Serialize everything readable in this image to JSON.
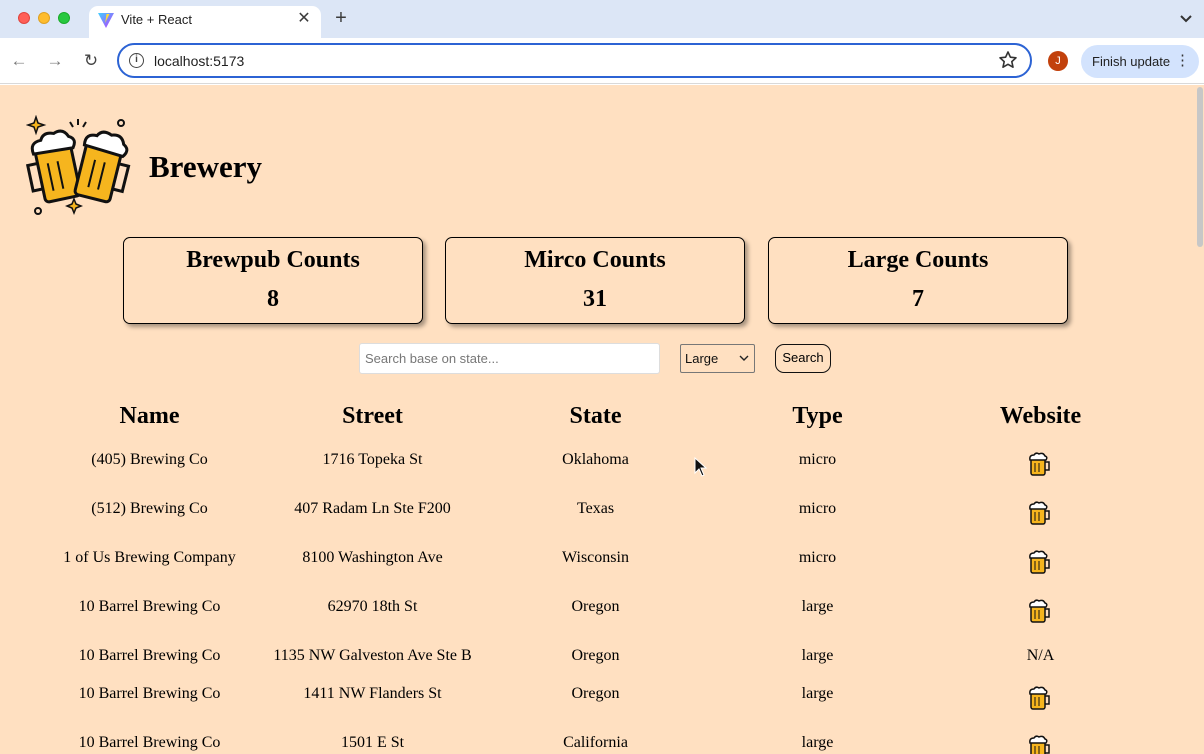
{
  "browser": {
    "tab_title": "Vite + React",
    "url": "localhost:5173",
    "profile_initial": "J",
    "finish_update_label": "Finish update"
  },
  "app": {
    "brand": "Brewery"
  },
  "stats": [
    {
      "label": "Brewpub Counts",
      "value": "8"
    },
    {
      "label": "Mirco Counts",
      "value": "31"
    },
    {
      "label": "Large Counts",
      "value": "7"
    }
  ],
  "search": {
    "placeholder": "Search base on state...",
    "value": "",
    "type_selected": "Large",
    "button_label": "Search"
  },
  "table": {
    "headers": [
      "Name",
      "Street",
      "State",
      "Type",
      "Website"
    ],
    "rows": [
      {
        "name": "(405) Brewing Co",
        "street": "1716 Topeka St",
        "state": "Oklahoma",
        "type": "micro",
        "website": "beer-mug-icon"
      },
      {
        "name": "(512) Brewing Co",
        "street": "407 Radam Ln Ste F200",
        "state": "Texas",
        "type": "micro",
        "website": "beer-mug-icon"
      },
      {
        "name": "1 of Us Brewing Company",
        "street": "8100 Washington Ave",
        "state": "Wisconsin",
        "type": "micro",
        "website": "beer-mug-icon"
      },
      {
        "name": "10 Barrel Brewing Co",
        "street": "62970 18th St",
        "state": "Oregon",
        "type": "large",
        "website": "beer-mug-icon"
      },
      {
        "name": "10 Barrel Brewing Co",
        "street": "1135 NW Galveston Ave Ste B",
        "state": "Oregon",
        "type": "large",
        "website": "N/A"
      },
      {
        "name": "10 Barrel Brewing Co",
        "street": "1411 NW Flanders St",
        "state": "Oregon",
        "type": "large",
        "website": "beer-mug-icon"
      },
      {
        "name": "10 Barrel Brewing Co",
        "street": "1501 E St",
        "state": "California",
        "type": "large",
        "website": "beer-mug-icon"
      }
    ]
  },
  "colors": {
    "page_background": "#ffe0c1",
    "tabstrip": "#dce6f6",
    "omnibox_border": "#2c63d4",
    "finish_update_bg": "#d3e3fd"
  }
}
